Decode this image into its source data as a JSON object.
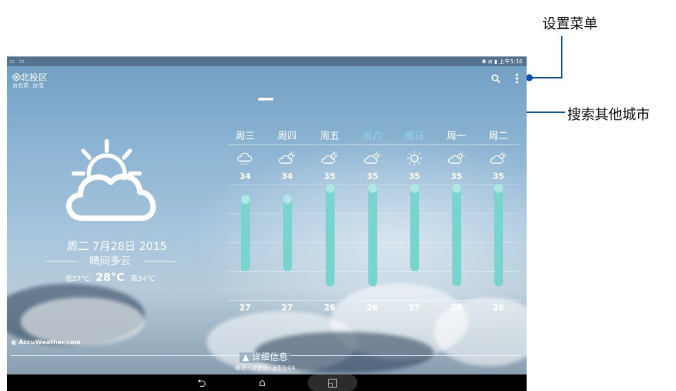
{
  "annotations": {
    "settings_menu": "设置菜单",
    "search_cities": "搜索其他城市"
  },
  "statusbar": {
    "left_icons": "▭ ▭",
    "right_text": "✱ ⋒ ▮ 上午5:16"
  },
  "location": {
    "name": "北投区",
    "pin_icon": "location-target-icon",
    "subtitle": "台北市, 台湾"
  },
  "toolbar": {
    "search_icon": "search-icon",
    "menu_icon": "overflow-menu-icon"
  },
  "today": {
    "icon": "sun-behind-cloud-icon",
    "date": "周二 7月28日 2015",
    "condition": "晴间多云",
    "low_label": "低",
    "low": "27°C",
    "current": "28°C",
    "high_label": "高",
    "high": "34°C"
  },
  "forecast": [
    {
      "day": "周三",
      "icon": "cloud-rain-icon",
      "high": "34",
      "low": "27",
      "weekend": false
    },
    {
      "day": "周四",
      "icon": "partly-sunny-icon",
      "high": "34",
      "low": "27",
      "weekend": false
    },
    {
      "day": "周五",
      "icon": "partly-sunny-icon",
      "high": "35",
      "low": "26",
      "weekend": false
    },
    {
      "day": "周六",
      "icon": "partly-sunny-icon",
      "high": "35",
      "low": "26",
      "weekend": true
    },
    {
      "day": "周日",
      "icon": "sun-icon",
      "high": "35",
      "low": "27",
      "weekend": true
    },
    {
      "day": "周一",
      "icon": "partly-sunny-icon",
      "high": "35",
      "low": "26",
      "weekend": false
    },
    {
      "day": "周二",
      "icon": "partly-sunny-icon",
      "high": "35",
      "low": "26",
      "weekend": false
    }
  ],
  "footer": {
    "brand": "◉ AccuWeather.com",
    "details": "▲ 详细信息",
    "updated": "最近一次更新: 上午5:04"
  },
  "navbar": {
    "back": "⮌",
    "home": "⌂",
    "recents": "◱"
  },
  "colors": {
    "accent_callout": "#0b4da2",
    "bar": "#79d4d0",
    "weekend_day": "#8fd5ee"
  }
}
